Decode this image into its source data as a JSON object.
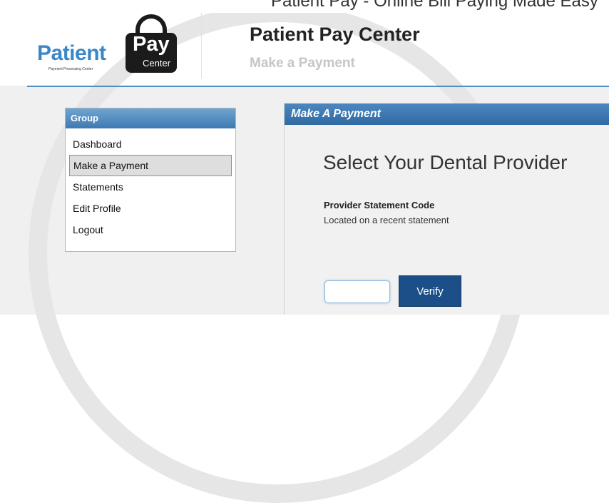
{
  "browser_fragment": "Patient Pay - Online Bill Paying Made Easy",
  "logo": {
    "word": "Patient",
    "tagline": "Payment Processing Center",
    "lock_top": "Pay",
    "lock_bottom": "Center"
  },
  "header": {
    "title": "Patient Pay Center",
    "subtitle": "Make a Payment"
  },
  "sidebar": {
    "title": "Group",
    "items": [
      {
        "label": "Dashboard"
      },
      {
        "label": "Make a Payment"
      },
      {
        "label": "Statements"
      },
      {
        "label": "Edit Profile"
      },
      {
        "label": "Logout"
      }
    ],
    "active_index": 1
  },
  "panel": {
    "title": "Make A Payment",
    "heading": "Select Your Dental Provider",
    "field_label": "Provider Statement Code",
    "field_help": "Located on a recent statement",
    "input_value": "",
    "verify_label": "Verify"
  },
  "colors": {
    "accent": "#3e79b2",
    "button": "#1c4f88",
    "logo_blue": "#3a87c8"
  }
}
